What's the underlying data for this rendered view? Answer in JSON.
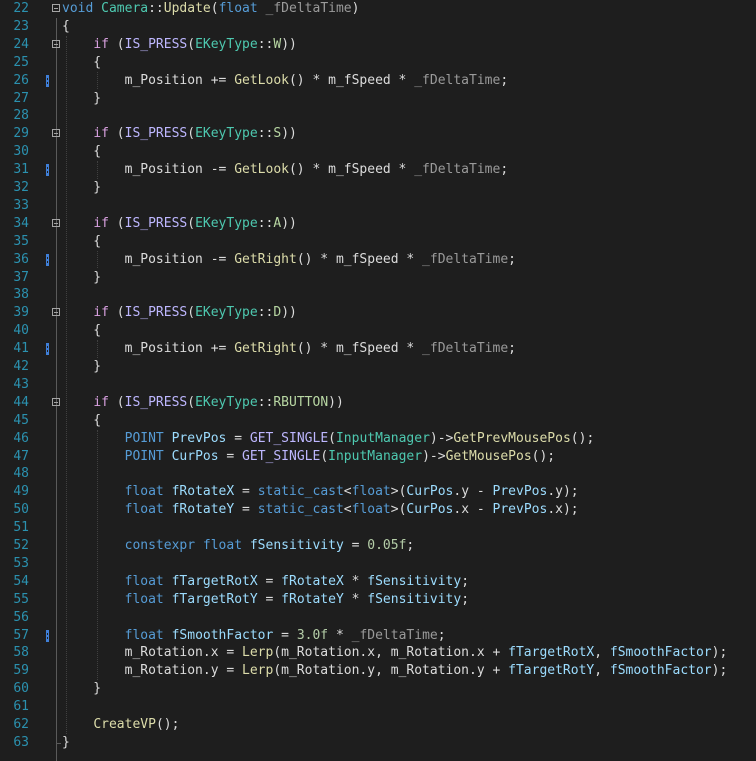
{
  "editor": {
    "lines": [
      {
        "n": "22",
        "fold": true,
        "mark": false,
        "tokens": [
          [
            "kw",
            "void "
          ],
          [
            "ty",
            "Camera"
          ],
          [
            "pl",
            "::"
          ],
          [
            "fn",
            "Update"
          ],
          [
            "pl",
            "("
          ],
          [
            "kw",
            "float "
          ],
          [
            "pa",
            "_fDeltaTime"
          ],
          [
            "pl",
            ")"
          ]
        ]
      },
      {
        "n": "23",
        "fold": false,
        "mark": false,
        "tokens": [
          [
            "pl",
            "{"
          ]
        ]
      },
      {
        "n": "24",
        "fold": true,
        "mark": false,
        "tokens": [
          [
            "pl",
            "    "
          ],
          [
            "cf",
            "if "
          ],
          [
            "pl",
            "("
          ],
          [
            "mc",
            "IS_PRESS"
          ],
          [
            "pl",
            "("
          ],
          [
            "ty",
            "EKeyType"
          ],
          [
            "pl",
            "::"
          ],
          [
            "en",
            "W"
          ],
          [
            "pl",
            "))"
          ]
        ]
      },
      {
        "n": "25",
        "fold": false,
        "mark": false,
        "tokens": [
          [
            "pl",
            "    {"
          ]
        ]
      },
      {
        "n": "26",
        "fold": false,
        "mark": true,
        "tokens": [
          [
            "pl",
            "        m_Position += "
          ],
          [
            "fn",
            "GetLook"
          ],
          [
            "pl",
            "() * m_fSpeed * "
          ],
          [
            "pa",
            "_fDeltaTime"
          ],
          [
            "pl",
            ";"
          ]
        ]
      },
      {
        "n": "27",
        "fold": false,
        "mark": false,
        "tokens": [
          [
            "pl",
            "    }"
          ]
        ]
      },
      {
        "n": "28",
        "fold": false,
        "mark": false,
        "tokens": []
      },
      {
        "n": "29",
        "fold": true,
        "mark": false,
        "tokens": [
          [
            "pl",
            "    "
          ],
          [
            "cf",
            "if "
          ],
          [
            "pl",
            "("
          ],
          [
            "mc",
            "IS_PRESS"
          ],
          [
            "pl",
            "("
          ],
          [
            "ty",
            "EKeyType"
          ],
          [
            "pl",
            "::"
          ],
          [
            "en",
            "S"
          ],
          [
            "pl",
            "))"
          ]
        ]
      },
      {
        "n": "30",
        "fold": false,
        "mark": false,
        "tokens": [
          [
            "pl",
            "    {"
          ]
        ]
      },
      {
        "n": "31",
        "fold": false,
        "mark": true,
        "tokens": [
          [
            "pl",
            "        m_Position -= "
          ],
          [
            "fn",
            "GetLook"
          ],
          [
            "pl",
            "() * m_fSpeed * "
          ],
          [
            "pa",
            "_fDeltaTime"
          ],
          [
            "pl",
            ";"
          ]
        ]
      },
      {
        "n": "32",
        "fold": false,
        "mark": false,
        "tokens": [
          [
            "pl",
            "    }"
          ]
        ]
      },
      {
        "n": "33",
        "fold": false,
        "mark": false,
        "tokens": []
      },
      {
        "n": "34",
        "fold": true,
        "mark": false,
        "tokens": [
          [
            "pl",
            "    "
          ],
          [
            "cf",
            "if "
          ],
          [
            "pl",
            "("
          ],
          [
            "mc",
            "IS_PRESS"
          ],
          [
            "pl",
            "("
          ],
          [
            "ty",
            "EKeyType"
          ],
          [
            "pl",
            "::"
          ],
          [
            "en",
            "A"
          ],
          [
            "pl",
            "))"
          ]
        ]
      },
      {
        "n": "35",
        "fold": false,
        "mark": false,
        "tokens": [
          [
            "pl",
            "    {"
          ]
        ]
      },
      {
        "n": "36",
        "fold": false,
        "mark": true,
        "tokens": [
          [
            "pl",
            "        m_Position -= "
          ],
          [
            "fn",
            "GetRight"
          ],
          [
            "pl",
            "() * m_fSpeed * "
          ],
          [
            "pa",
            "_fDeltaTime"
          ],
          [
            "pl",
            ";"
          ]
        ]
      },
      {
        "n": "37",
        "fold": false,
        "mark": false,
        "tokens": [
          [
            "pl",
            "    }"
          ]
        ]
      },
      {
        "n": "38",
        "fold": false,
        "mark": false,
        "tokens": []
      },
      {
        "n": "39",
        "fold": true,
        "mark": false,
        "tokens": [
          [
            "pl",
            "    "
          ],
          [
            "cf",
            "if "
          ],
          [
            "pl",
            "("
          ],
          [
            "mc",
            "IS_PRESS"
          ],
          [
            "pl",
            "("
          ],
          [
            "ty",
            "EKeyType"
          ],
          [
            "pl",
            "::"
          ],
          [
            "en",
            "D"
          ],
          [
            "pl",
            "))"
          ]
        ]
      },
      {
        "n": "40",
        "fold": false,
        "mark": false,
        "tokens": [
          [
            "pl",
            "    {"
          ]
        ]
      },
      {
        "n": "41",
        "fold": false,
        "mark": true,
        "tokens": [
          [
            "pl",
            "        m_Position += "
          ],
          [
            "fn",
            "GetRight"
          ],
          [
            "pl",
            "() * m_fSpeed * "
          ],
          [
            "pa",
            "_fDeltaTime"
          ],
          [
            "pl",
            ";"
          ]
        ]
      },
      {
        "n": "42",
        "fold": false,
        "mark": false,
        "tokens": [
          [
            "pl",
            "    }"
          ]
        ]
      },
      {
        "n": "43",
        "fold": false,
        "mark": false,
        "tokens": []
      },
      {
        "n": "44",
        "fold": true,
        "mark": false,
        "tokens": [
          [
            "pl",
            "    "
          ],
          [
            "cf",
            "if "
          ],
          [
            "pl",
            "("
          ],
          [
            "mc",
            "IS_PRESS"
          ],
          [
            "pl",
            "("
          ],
          [
            "ty",
            "EKeyType"
          ],
          [
            "pl",
            "::"
          ],
          [
            "en",
            "RBUTTON"
          ],
          [
            "pl",
            "))"
          ]
        ]
      },
      {
        "n": "45",
        "fold": false,
        "mark": false,
        "tokens": [
          [
            "pl",
            "    {"
          ]
        ]
      },
      {
        "n": "46",
        "fold": false,
        "mark": false,
        "tokens": [
          [
            "pl",
            "        "
          ],
          [
            "kw",
            "POINT "
          ],
          [
            "lv",
            "PrevPos"
          ],
          [
            "pl",
            " = "
          ],
          [
            "mc",
            "GET_SINGLE"
          ],
          [
            "pl",
            "("
          ],
          [
            "ty",
            "InputManager"
          ],
          [
            "pl",
            ")->"
          ],
          [
            "fn",
            "GetPrevMousePos"
          ],
          [
            "pl",
            "();"
          ]
        ]
      },
      {
        "n": "47",
        "fold": false,
        "mark": false,
        "tokens": [
          [
            "pl",
            "        "
          ],
          [
            "kw",
            "POINT "
          ],
          [
            "lv",
            "CurPos"
          ],
          [
            "pl",
            " = "
          ],
          [
            "mc",
            "GET_SINGLE"
          ],
          [
            "pl",
            "("
          ],
          [
            "ty",
            "InputManager"
          ],
          [
            "pl",
            ")->"
          ],
          [
            "fn",
            "GetMousePos"
          ],
          [
            "pl",
            "();"
          ]
        ]
      },
      {
        "n": "48",
        "fold": false,
        "mark": false,
        "tokens": []
      },
      {
        "n": "49",
        "fold": false,
        "mark": false,
        "tokens": [
          [
            "pl",
            "        "
          ],
          [
            "kw",
            "float "
          ],
          [
            "lv",
            "fRotateX"
          ],
          [
            "pl",
            " = "
          ],
          [
            "kw",
            "static_cast"
          ],
          [
            "pl",
            "<"
          ],
          [
            "kw",
            "float"
          ],
          [
            "pl",
            ">("
          ],
          [
            "lv",
            "CurPos"
          ],
          [
            "pl",
            ".y - "
          ],
          [
            "lv",
            "PrevPos"
          ],
          [
            "pl",
            ".y);"
          ]
        ]
      },
      {
        "n": "50",
        "fold": false,
        "mark": false,
        "tokens": [
          [
            "pl",
            "        "
          ],
          [
            "kw",
            "float "
          ],
          [
            "lv",
            "fRotateY"
          ],
          [
            "pl",
            " = "
          ],
          [
            "kw",
            "static_cast"
          ],
          [
            "pl",
            "<"
          ],
          [
            "kw",
            "float"
          ],
          [
            "pl",
            ">("
          ],
          [
            "lv",
            "CurPos"
          ],
          [
            "pl",
            ".x - "
          ],
          [
            "lv",
            "PrevPos"
          ],
          [
            "pl",
            ".x);"
          ]
        ]
      },
      {
        "n": "51",
        "fold": false,
        "mark": false,
        "tokens": []
      },
      {
        "n": "52",
        "fold": false,
        "mark": false,
        "tokens": [
          [
            "pl",
            "        "
          ],
          [
            "kw",
            "constexpr float "
          ],
          [
            "lv",
            "fSensitivity"
          ],
          [
            "pl",
            " = "
          ],
          [
            "nu",
            "0.05f"
          ],
          [
            "pl",
            ";"
          ]
        ]
      },
      {
        "n": "53",
        "fold": false,
        "mark": false,
        "tokens": []
      },
      {
        "n": "54",
        "fold": false,
        "mark": false,
        "tokens": [
          [
            "pl",
            "        "
          ],
          [
            "kw",
            "float "
          ],
          [
            "lv",
            "fTargetRotX"
          ],
          [
            "pl",
            " = "
          ],
          [
            "lv",
            "fRotateX"
          ],
          [
            "pl",
            " * "
          ],
          [
            "lv",
            "fSensitivity"
          ],
          [
            "pl",
            ";"
          ]
        ]
      },
      {
        "n": "55",
        "fold": false,
        "mark": false,
        "tokens": [
          [
            "pl",
            "        "
          ],
          [
            "kw",
            "float "
          ],
          [
            "lv",
            "fTargetRotY"
          ],
          [
            "pl",
            " = "
          ],
          [
            "lv",
            "fRotateY"
          ],
          [
            "pl",
            " * "
          ],
          [
            "lv",
            "fSensitivity"
          ],
          [
            "pl",
            ";"
          ]
        ]
      },
      {
        "n": "56",
        "fold": false,
        "mark": false,
        "tokens": []
      },
      {
        "n": "57",
        "fold": false,
        "mark": true,
        "tokens": [
          [
            "pl",
            "        "
          ],
          [
            "kw",
            "float "
          ],
          [
            "lv",
            "fSmoothFactor"
          ],
          [
            "pl",
            " = "
          ],
          [
            "nu",
            "3.0f"
          ],
          [
            "pl",
            " * "
          ],
          [
            "pa",
            "_fDeltaTime"
          ],
          [
            "pl",
            ";"
          ]
        ]
      },
      {
        "n": "58",
        "fold": false,
        "mark": false,
        "tokens": [
          [
            "pl",
            "        m_Rotation.x = "
          ],
          [
            "fn",
            "Lerp"
          ],
          [
            "pl",
            "(m_Rotation.x, m_Rotation.x + "
          ],
          [
            "lv",
            "fTargetRotX"
          ],
          [
            "pl",
            ", "
          ],
          [
            "lv",
            "fSmoothFactor"
          ],
          [
            "pl",
            ");"
          ]
        ]
      },
      {
        "n": "59",
        "fold": false,
        "mark": false,
        "tokens": [
          [
            "pl",
            "        m_Rotation.y = "
          ],
          [
            "fn",
            "Lerp"
          ],
          [
            "pl",
            "(m_Rotation.y, m_Rotation.y + "
          ],
          [
            "lv",
            "fTargetRotY"
          ],
          [
            "pl",
            ", "
          ],
          [
            "lv",
            "fSmoothFactor"
          ],
          [
            "pl",
            ");"
          ]
        ]
      },
      {
        "n": "60",
        "fold": false,
        "mark": false,
        "tokens": [
          [
            "pl",
            "    }"
          ]
        ]
      },
      {
        "n": "61",
        "fold": false,
        "mark": false,
        "tokens": []
      },
      {
        "n": "62",
        "fold": false,
        "mark": false,
        "tokens": [
          [
            "pl",
            "    "
          ],
          [
            "fn",
            "CreateVP"
          ],
          [
            "pl",
            "();"
          ]
        ]
      },
      {
        "n": "63",
        "fold": false,
        "mark": false,
        "tokens": [
          [
            "pl",
            "}"
          ]
        ]
      }
    ]
  }
}
